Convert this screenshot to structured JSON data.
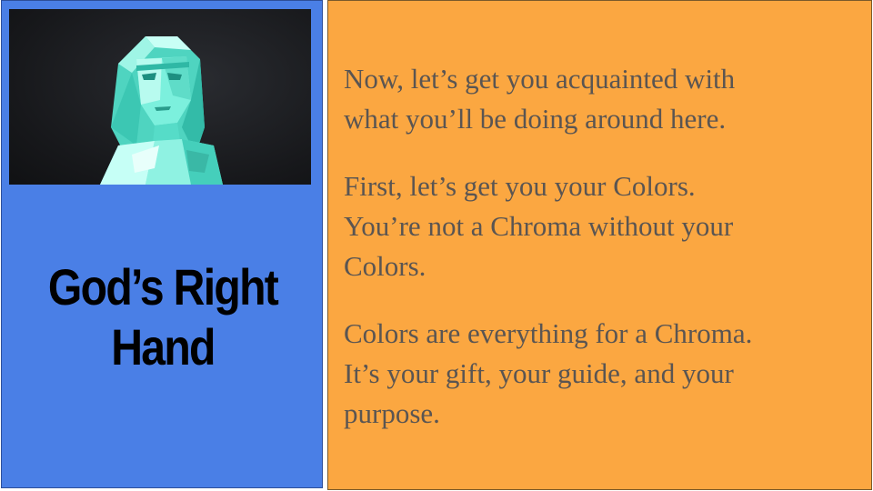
{
  "speaker": {
    "name_line1": "God’s Right",
    "name_line2": "Hand",
    "portrait_icon": "crystal-figure-icon"
  },
  "dialogue": {
    "paragraphs": [
      "Now, let’s get you acquainted with\nwhat you’ll be doing around here.",
      "First, let’s get you your Colors.\nYou’re not a Chroma without your\nColors.",
      "Colors are everything for a Chroma.\nIt’s your gift, your guide, and your\npurpose."
    ]
  },
  "colors": {
    "speaker_panel": "#4a7fe6",
    "dialogue_panel": "#fba741",
    "dialogue_text": "#5a5552",
    "portrait_bg": "#17181b",
    "figure": "#5ee6d2"
  }
}
